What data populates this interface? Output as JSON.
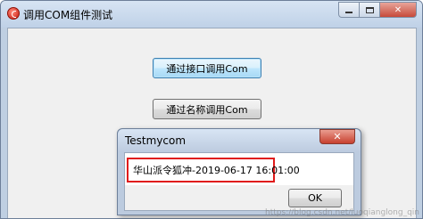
{
  "main_window": {
    "title": "调用COM组件测试",
    "buttons": {
      "call_by_interface": "通过接口调用Com",
      "call_by_name": "通过名称调用Com"
    }
  },
  "dialog": {
    "title": "Testmycom",
    "message": "华山派令狐冲-2019-06-17 16:01:00",
    "ok_label": "OK"
  },
  "colors": {
    "highlight_border": "#e01b1b",
    "close_button": "#c64a3a"
  },
  "watermark": "https://blog.csdn.net/luoqianglong_qin"
}
